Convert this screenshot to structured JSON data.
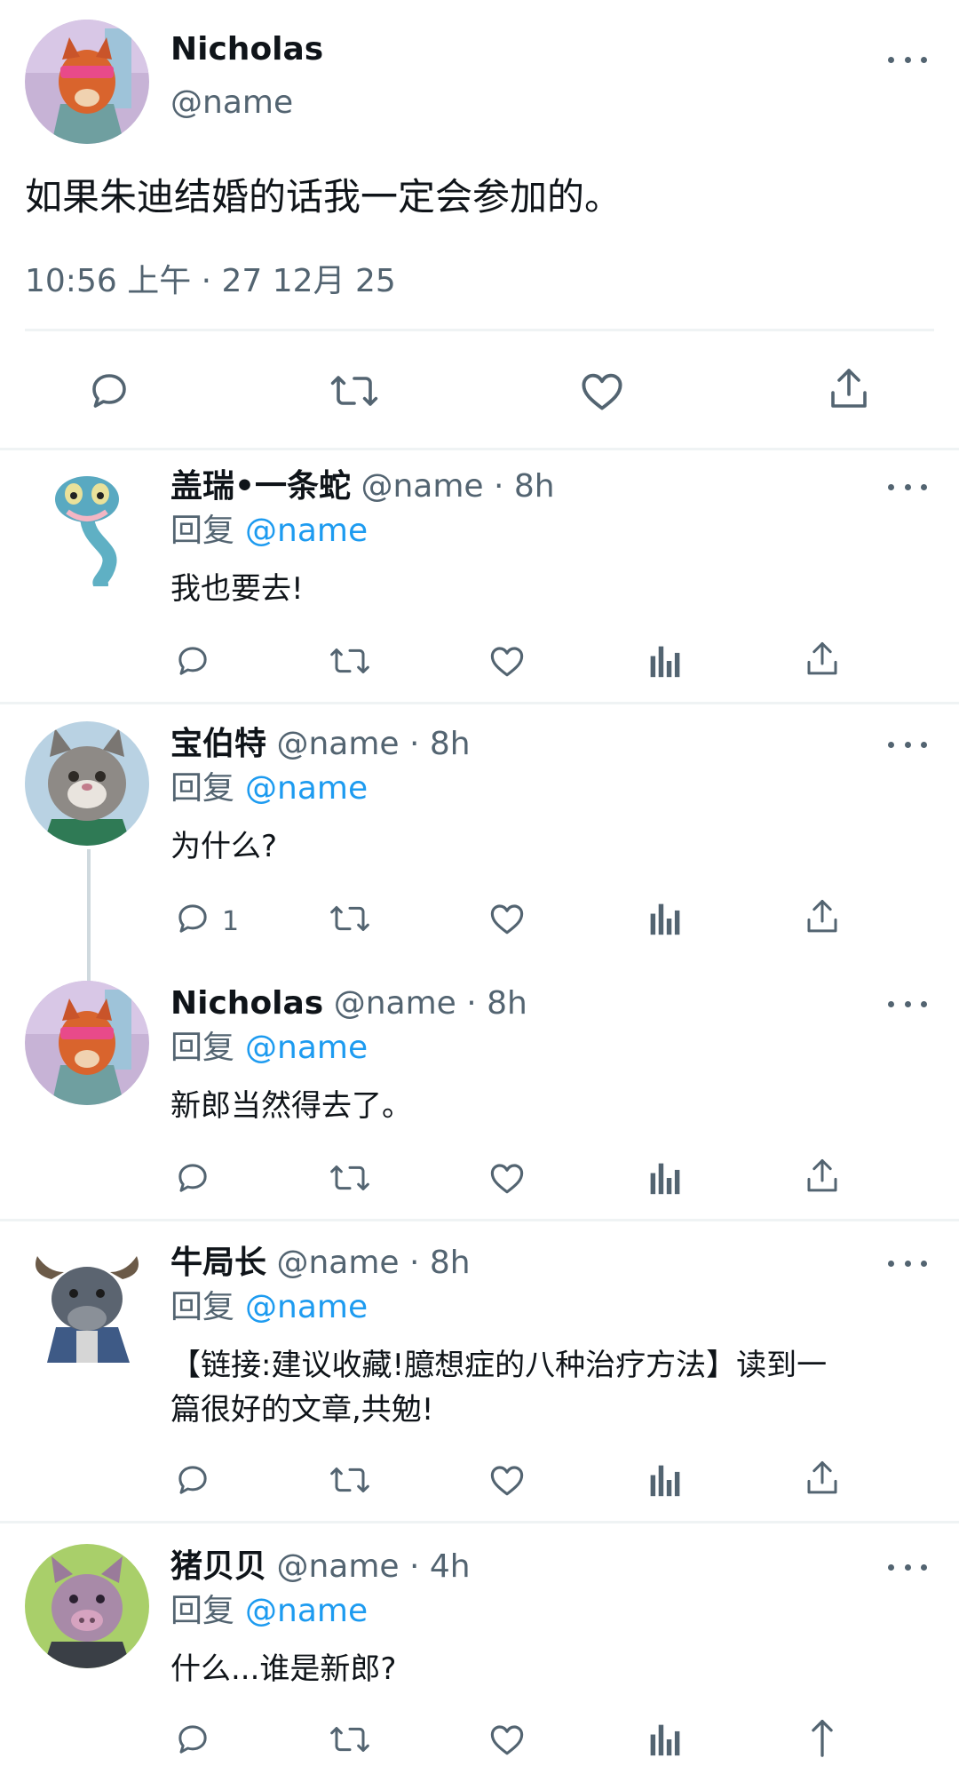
{
  "main_tweet": {
    "name": "Nicholas",
    "handle": "@name",
    "text": "如果朱迪结婚的话我一定会参加的。",
    "timestamp": "10:56 上午 · 27 12月 25"
  },
  "replies": [
    {
      "name": "盖瑞•一条蛇",
      "meta": "@name · 8h",
      "reply_label": "回复",
      "mention": "@name",
      "text": "我也要去!"
    },
    {
      "name": "宝伯特",
      "meta": "@name · 8h",
      "reply_label": "回复",
      "mention": "@name",
      "text": "为什么?",
      "reply_count": "1"
    },
    {
      "name": "Nicholas",
      "meta": "@name · 8h",
      "reply_label": "回复",
      "mention": "@name",
      "text": "新郎当然得去了。"
    },
    {
      "name": "牛局长",
      "meta": "@name · 8h",
      "reply_label": "回复",
      "mention": "@name",
      "text_line1": "【链接:建议收藏!臆想症的八种治疗方法】读到一",
      "text_line2": "篇很好的文章,共勉!"
    },
    {
      "name": "猪贝贝",
      "meta": "@name · 4h",
      "reply_label": "回复",
      "mention": "@name",
      "text": "什么...谁是新郎?"
    }
  ],
  "colors": {
    "text": "#0f1419",
    "secondary": "#536471",
    "link": "#1d9bf0",
    "divider": "#eff3f4"
  }
}
